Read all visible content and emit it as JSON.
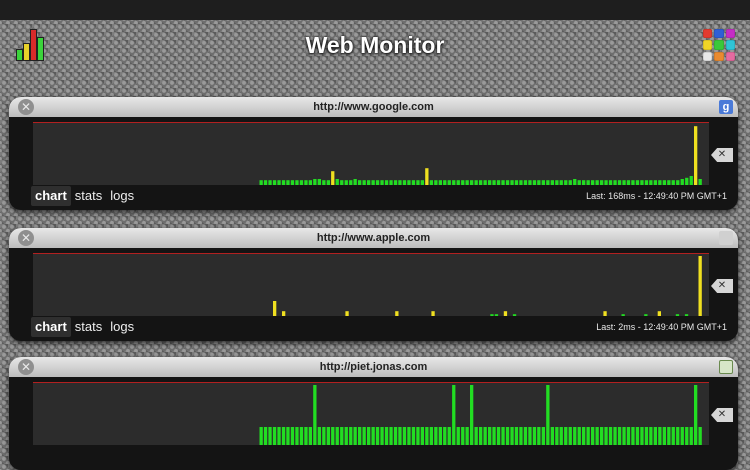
{
  "app": {
    "title": "Web Monitor",
    "colors": {
      "bar_ok": "#22dd22",
      "bar_slow": "#f0e020",
      "accent": "#b22020"
    }
  },
  "header": {
    "logo_icon": "signal-bars-icon",
    "grid_icon": "color-grid-icon"
  },
  "monitors": [
    {
      "url": "http://www.google.com",
      "favicon": "google-icon",
      "favicon_letter": "g",
      "tabs": [
        {
          "label": "chart"
        },
        {
          "label": "stats"
        },
        {
          "label": "logs"
        }
      ],
      "last": "Last: 168ms - 12:49:40 PM GMT+1",
      "chart_data": {
        "type": "bar",
        "ylim": [
          0,
          1
        ],
        "start_frac": 0.335,
        "bars": [
          0.08,
          0.08,
          0.08,
          0.08,
          0.08,
          0.08,
          0.08,
          0.08,
          0.08,
          0.08,
          0.08,
          0.08,
          0.1,
          0.1,
          0.08,
          0.08,
          0.23,
          0.1,
          0.08,
          0.08,
          0.08,
          0.1,
          0.08,
          0.08,
          0.08,
          0.08,
          0.08,
          0.08,
          0.08,
          0.08,
          0.08,
          0.08,
          0.08,
          0.08,
          0.08,
          0.08,
          0.08,
          0.28,
          0.08,
          0.08,
          0.08,
          0.08,
          0.08,
          0.08,
          0.08,
          0.08,
          0.08,
          0.08,
          0.08,
          0.08,
          0.08,
          0.08,
          0.08,
          0.08,
          0.08,
          0.08,
          0.08,
          0.08,
          0.08,
          0.08,
          0.08,
          0.08,
          0.08,
          0.08,
          0.08,
          0.08,
          0.08,
          0.08,
          0.08,
          0.08,
          0.1,
          0.08,
          0.08,
          0.08,
          0.08,
          0.08,
          0.08,
          0.08,
          0.08,
          0.08,
          0.08,
          0.08,
          0.08,
          0.08,
          0.08,
          0.08,
          0.08,
          0.08,
          0.08,
          0.08,
          0.08,
          0.08,
          0.08,
          0.08,
          0.1,
          0.12,
          0.15,
          0.98,
          0.1
        ],
        "slow": [
          16,
          37,
          97
        ]
      }
    },
    {
      "url": "http://www.apple.com",
      "favicon": "apple-icon",
      "favicon_letter": "",
      "tabs": [
        {
          "label": "chart"
        },
        {
          "label": "stats"
        },
        {
          "label": "logs"
        }
      ],
      "last": "Last: 2ms - 12:49:40 PM GMT+1",
      "chart_data": {
        "type": "bar",
        "ylim": [
          0,
          1
        ],
        "start_frac": 0.355,
        "bars": [
          0.25,
          0,
          0.08,
          0,
          0,
          0,
          0,
          0,
          0,
          0,
          0,
          0,
          0,
          0,
          0,
          0,
          0.08,
          0,
          0,
          0,
          0,
          0,
          0,
          0,
          0,
          0,
          0,
          0.08,
          0,
          0,
          0,
          0,
          0,
          0,
          0,
          0.08,
          0,
          0,
          0,
          0,
          0,
          0,
          0,
          0,
          0,
          0,
          0,
          0,
          0.03,
          0.03,
          0,
          0.08,
          0,
          0.03,
          0,
          0,
          0,
          0,
          0,
          0,
          0,
          0,
          0,
          0,
          0,
          0,
          0,
          0,
          0,
          0,
          0,
          0,
          0,
          0.08,
          0,
          0,
          0,
          0.03,
          0,
          0,
          0,
          0,
          0.03,
          0,
          0,
          0.08,
          0,
          0,
          0,
          0.03,
          0,
          0.03,
          0,
          0,
          1.0
        ],
        "slow": [
          0,
          2,
          16,
          27,
          35,
          51,
          73,
          85,
          94
        ]
      }
    },
    {
      "url": "http://piet.jonas.com",
      "favicon": "piet-icon",
      "favicon_letter": "",
      "tabs": [
        {
          "label": "chart"
        },
        {
          "label": "stats"
        },
        {
          "label": "logs"
        }
      ],
      "last": "",
      "chart_data": {
        "type": "bar",
        "ylim": [
          0,
          1
        ],
        "start_frac": 0.335,
        "bars": [
          0.3,
          0.3,
          0.3,
          0.3,
          0.3,
          0.3,
          0.3,
          0.3,
          0.3,
          0.3,
          0.3,
          0.3,
          0.3,
          0.3,
          0.3,
          0.3,
          0.3,
          0.3,
          0.3,
          0.3,
          0.3,
          0.3,
          0.3,
          0.3,
          0.3,
          0.3,
          0.3,
          0.3,
          0.3,
          0.3,
          0.3,
          0.3,
          0.3,
          0.3,
          0.3,
          0.3,
          0.3,
          0.3,
          0.3,
          0.3,
          0.3,
          0.3,
          0.3,
          0.3,
          0.3,
          0.3,
          0.3,
          0.3,
          0.3,
          0.3,
          0.3,
          0.3,
          0.3,
          0.3,
          0.3,
          0.3,
          0.3,
          0.3,
          0.3,
          0.3,
          0.3,
          0.3,
          0.3,
          0.3,
          0.3,
          0.3,
          0.3,
          0.3,
          0.3,
          0.3,
          0.3,
          0.3,
          0.3,
          0.3,
          0.3,
          0.3,
          0.3,
          0.3,
          0.3,
          0.3,
          0.3,
          0.3,
          0.3,
          0.3,
          0.3,
          0.3,
          0.3,
          0.3,
          0.3,
          0.3,
          0.3,
          0.3,
          0.3,
          0.3,
          0.3,
          0.3,
          0.3,
          0.3,
          0.3
        ],
        "tall": [
          12,
          43,
          47,
          64,
          97
        ],
        "slow": []
      }
    }
  ]
}
